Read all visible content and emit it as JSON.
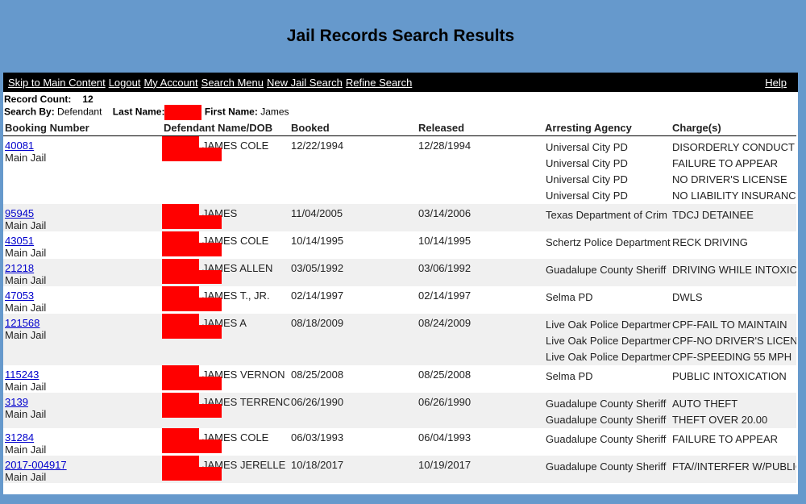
{
  "header": {
    "title": "Jail Records Search Results"
  },
  "nav": {
    "skip": "Skip to Main Content",
    "logout": "Logout",
    "account": "My Account",
    "search_menu": "Search Menu",
    "new_search": "New Jail Search",
    "refine": "Refine Search",
    "help": "Help"
  },
  "meta": {
    "record_count_label": "Record Count:",
    "record_count": "12",
    "search_by_label": "Search By:",
    "search_by": "Defendant",
    "last_name_label": "Last Name:",
    "first_name_label": "First Name:",
    "first_name": "James"
  },
  "columns": [
    "Booking Number",
    "Defendant Name/DOB",
    "Booked",
    "Released",
    "Arresting Agency",
    "Charge(s)"
  ],
  "records": [
    {
      "booking": "40081",
      "facility": "Main Jail",
      "name": "JAMES COLE",
      "booked": "12/22/1994",
      "released": "12/28/1994",
      "charges": [
        {
          "agency": "Universal City PD",
          "charge": "DISORDERLY CONDUCT"
        },
        {
          "agency": "Universal City PD",
          "charge": "FAILURE TO APPEAR"
        },
        {
          "agency": "Universal City PD",
          "charge": "NO DRIVER'S LICENSE"
        },
        {
          "agency": "Universal City PD",
          "charge": "NO LIABILITY INSURANCE"
        }
      ]
    },
    {
      "booking": "95945",
      "facility": "Main Jail",
      "name": "JAMES",
      "booked": "11/04/2005",
      "released": "03/14/2006",
      "charges": [
        {
          "agency": "Texas Department of Crim",
          "charge": "TDCJ DETAINEE"
        }
      ]
    },
    {
      "booking": "43051",
      "facility": "Main Jail",
      "name": "JAMES COLE",
      "booked": "10/14/1995",
      "released": "10/14/1995",
      "charges": [
        {
          "agency": "Schertz Police Department",
          "charge": "RECK DRIVING"
        }
      ]
    },
    {
      "booking": "21218",
      "facility": "Main Jail",
      "name": "JAMES ALLEN",
      "booked": "03/05/1992",
      "released": "03/06/1992",
      "charges": [
        {
          "agency": "Guadalupe County Sheriff",
          "charge": "DRIVING WHILE INTOXICATED"
        }
      ]
    },
    {
      "booking": "47053",
      "facility": "Main Jail",
      "name": "JAMES T., JR.",
      "booked": "02/14/1997",
      "released": "02/14/1997",
      "charges": [
        {
          "agency": "Selma PD",
          "charge": "DWLS"
        }
      ]
    },
    {
      "booking": "121568",
      "facility": "Main Jail",
      "name": "JAMES A",
      "booked": "08/18/2009",
      "released": "08/24/2009",
      "charges": [
        {
          "agency": "Live Oak Police Department",
          "charge": "CPF-FAIL TO MAINTAIN"
        },
        {
          "agency": "Live Oak Police Department",
          "charge": "CPF-NO DRIVER'S LICENSE"
        },
        {
          "agency": "Live Oak Police Department",
          "charge": "CPF-SPEEDING 55 MPH"
        }
      ]
    },
    {
      "booking": "115243",
      "facility": "Main Jail",
      "name": "JAMES VERNON",
      "booked": "08/25/2008",
      "released": "08/25/2008",
      "charges": [
        {
          "agency": "Selma PD",
          "charge": "PUBLIC INTOXICATION"
        }
      ]
    },
    {
      "booking": "3139",
      "facility": "Main Jail",
      "name": "JAMES TERRENCE",
      "booked": "06/26/1990",
      "released": "06/26/1990",
      "charges": [
        {
          "agency": "Guadalupe County Sheriff",
          "charge": "AUTO THEFT"
        },
        {
          "agency": "Guadalupe County Sheriff",
          "charge": "THEFT OVER 20.00"
        }
      ]
    },
    {
      "booking": "31284",
      "facility": "Main Jail",
      "name": "JAMES COLE",
      "booked": "06/03/1993",
      "released": "06/04/1993",
      "charges": [
        {
          "agency": "Guadalupe County Sheriff",
          "charge": "FAILURE TO APPEAR"
        }
      ]
    },
    {
      "booking": "2017-004917",
      "facility": "Main Jail",
      "name": "JAMES JERELLE",
      "booked": "10/18/2017",
      "released": "10/19/2017",
      "charges": [
        {
          "agency": "Guadalupe County Sheriff",
          "charge": "FTA//INTERFER W/PUBLIC DUTIES"
        }
      ]
    }
  ]
}
